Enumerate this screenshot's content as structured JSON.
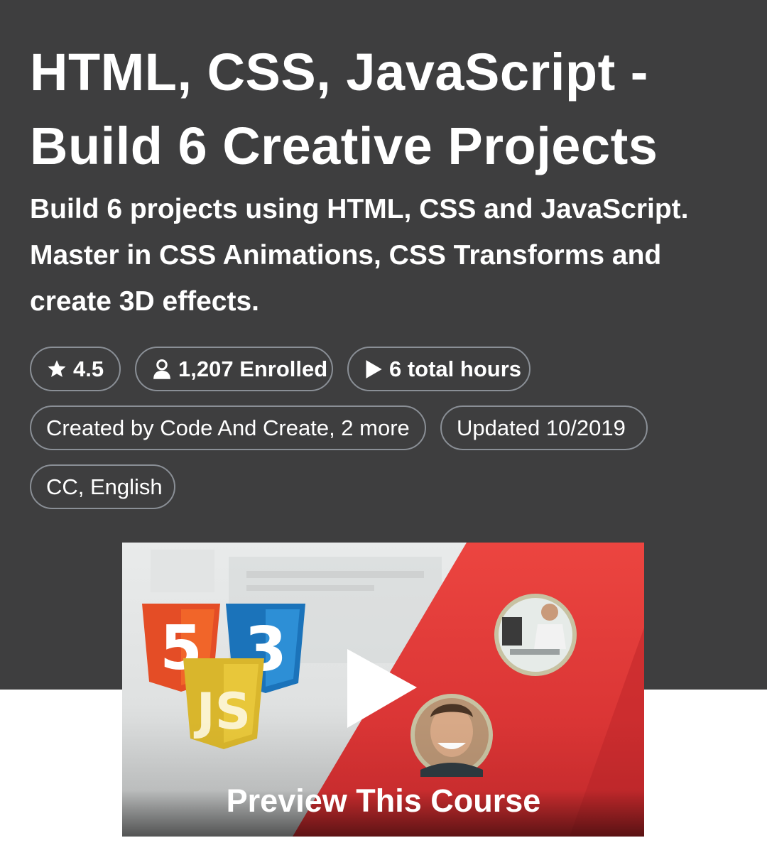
{
  "course": {
    "title": "HTML, CSS, JavaScript - Build 6 Creative Projects",
    "subtitle": "Build 6 projects using HTML, CSS and JavaScript. Master in CSS Animations, CSS Transforms and create 3D effects."
  },
  "stats": {
    "rating": "4.5",
    "enrolled": "1,207 Enrolled",
    "hours": "6 total hours"
  },
  "meta": {
    "created_by": "Created by Code And Create, 2 more",
    "updated": "Updated 10/2019",
    "captions": "CC, English"
  },
  "preview": {
    "label": "Preview This Course",
    "logos": {
      "html": "5",
      "css": "3",
      "js": "JS"
    }
  },
  "icons": {
    "rating": "star-icon",
    "enrolled": "user-icon",
    "hours": "play-icon",
    "preview": "play-icon"
  },
  "colors": {
    "hero_bg": "#3e3e3f",
    "chip_border": "#8a8f96",
    "html5_orange": "#e44d26",
    "css3_blue": "#1b73ba",
    "js_yellow": "#d9b62c",
    "accent_red": "#e2393a"
  }
}
